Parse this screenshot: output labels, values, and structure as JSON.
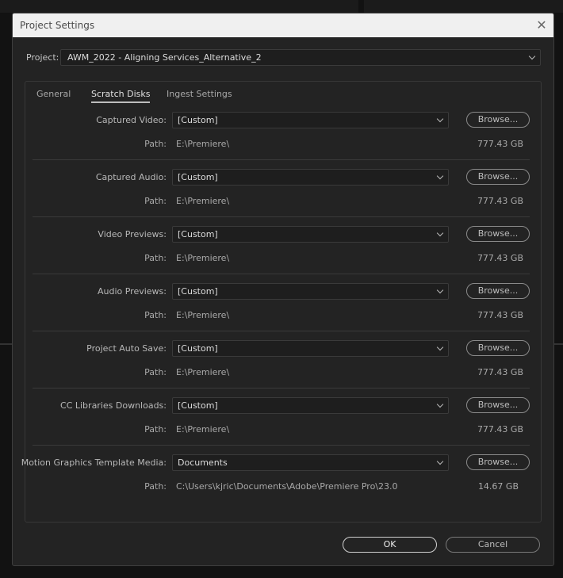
{
  "dialog": {
    "title": "Project Settings"
  },
  "project": {
    "label": "Project:",
    "value": "AWM_2022 - Aligning Services_Alternative_2"
  },
  "tabs": [
    {
      "label": "General",
      "active": false
    },
    {
      "label": "Scratch Disks",
      "active": true
    },
    {
      "label": "Ingest Settings",
      "active": false
    }
  ],
  "path_label": "Path:",
  "rows": [
    {
      "label": "Captured Video:",
      "value": "[Custom]",
      "browse": "Browse...",
      "path": "E:\\Premiere\\",
      "size": "777.43 GB"
    },
    {
      "label": "Captured Audio:",
      "value": "[Custom]",
      "browse": "Browse...",
      "path": "E:\\Premiere\\",
      "size": "777.43 GB"
    },
    {
      "label": "Video Previews:",
      "value": "[Custom]",
      "browse": "Browse...",
      "path": "E:\\Premiere\\",
      "size": "777.43 GB"
    },
    {
      "label": "Audio Previews:",
      "value": "[Custom]",
      "browse": "Browse...",
      "path": "E:\\Premiere\\",
      "size": "777.43 GB"
    },
    {
      "label": "Project Auto Save:",
      "value": "[Custom]",
      "browse": "Browse...",
      "path": "E:\\Premiere\\",
      "size": "777.43 GB"
    },
    {
      "label": "CC Libraries Downloads:",
      "value": "[Custom]",
      "browse": "Browse...",
      "path": "E:\\Premiere\\",
      "size": "777.43 GB"
    },
    {
      "label": "Motion Graphics Template Media:",
      "value": "Documents",
      "browse": "Browse...",
      "path": "C:\\Users\\kjric\\Documents\\Adobe\\Premiere Pro\\23.0",
      "size": "14.67 GB"
    }
  ],
  "buttons": {
    "ok": "OK",
    "cancel": "Cancel"
  }
}
